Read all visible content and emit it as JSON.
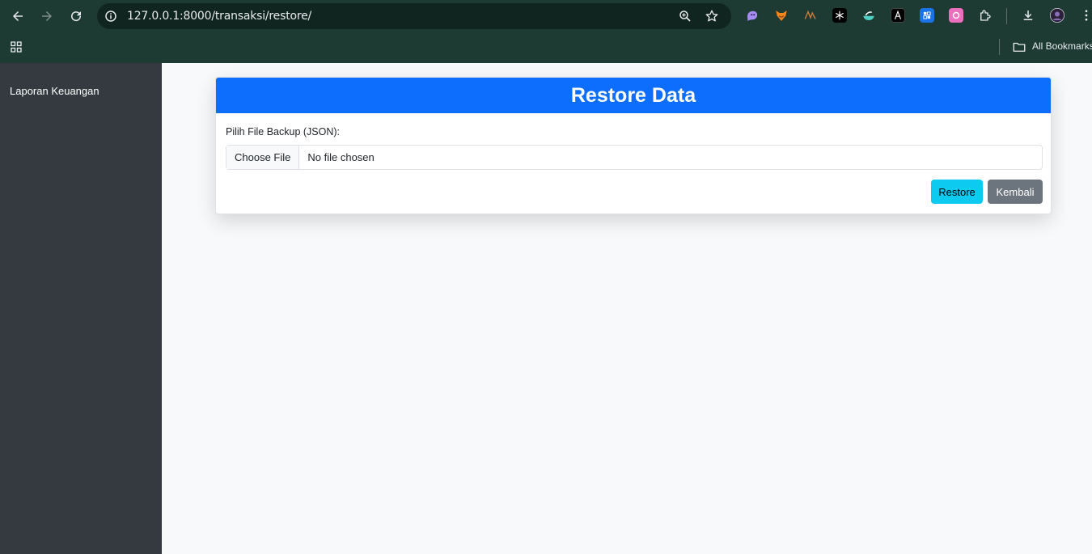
{
  "browser": {
    "url": "127.0.0.1:8000/transaksi/restore/",
    "bookmarks_label": "All Bookmarks"
  },
  "sidebar": {
    "title": "Laporan Keuangan"
  },
  "card": {
    "header": "Restore Data",
    "file_label": "Pilih File Backup (JSON):",
    "file_button": "Choose File",
    "file_status": "No file chosen",
    "restore_button": "Restore",
    "back_button": "Kembali"
  },
  "colors": {
    "primary": "#0d6efd",
    "info": "#0dcaf0",
    "secondary": "#6c757d",
    "sidebar_bg": "#343a40"
  }
}
